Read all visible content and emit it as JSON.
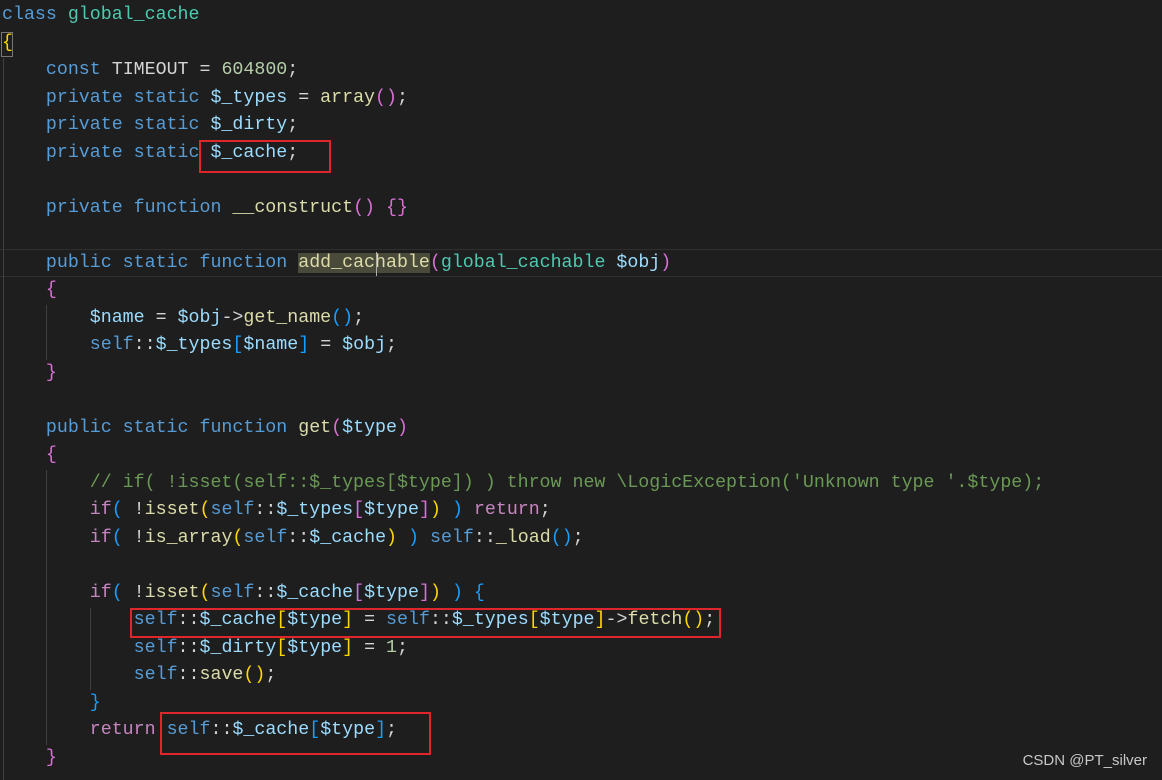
{
  "colors": {
    "keyword": "#569cd6",
    "class": "#4ec9b0",
    "variable": "#9cdcfe",
    "function": "#dcdcaa",
    "number": "#b5cea8",
    "comment": "#6a9955",
    "control": "#c586c0",
    "highlight_box": "#e0262a"
  },
  "code_lines": [
    [
      [
        "class ",
        "kw"
      ],
      [
        "global_cache",
        "cls"
      ]
    ],
    [
      [
        "{",
        "b1"
      ]
    ],
    [
      [
        "    const ",
        "kw"
      ],
      [
        "TIMEOUT = ",
        "def"
      ],
      [
        "604800",
        "num"
      ],
      [
        ";",
        "def"
      ]
    ],
    [
      [
        "    private static ",
        "kw"
      ],
      [
        "$_types",
        "var"
      ],
      [
        " = ",
        "def"
      ],
      [
        "array",
        "fn"
      ],
      [
        "(",
        "b2"
      ],
      [
        ")",
        "b2"
      ],
      [
        ";",
        "def"
      ]
    ],
    [
      [
        "    private static ",
        "kw"
      ],
      [
        "$_dirty",
        "var"
      ],
      [
        ";",
        "def"
      ]
    ],
    [
      [
        "    private static ",
        "kw"
      ],
      [
        "$_cache",
        "var"
      ],
      [
        ";",
        "def"
      ]
    ],
    [],
    [
      [
        "    private function ",
        "kw"
      ],
      [
        "__construct",
        "fn"
      ],
      [
        "()",
        "b2"
      ],
      [
        " ",
        "def"
      ],
      [
        "{}",
        "b2"
      ]
    ],
    [],
    [
      [
        "    public static function ",
        "kw"
      ],
      [
        "add_cachable",
        "hl"
      ],
      [
        "(",
        "b2"
      ],
      [
        "global_cachable ",
        "cls"
      ],
      [
        "$obj",
        "var"
      ],
      [
        ")",
        "b2"
      ]
    ],
    [
      [
        "    ",
        "def"
      ],
      [
        "{",
        "b2"
      ]
    ],
    [
      [
        "        ",
        "def"
      ],
      [
        "$name",
        "var"
      ],
      [
        " = ",
        "def"
      ],
      [
        "$obj",
        "var"
      ],
      [
        "->",
        "def"
      ],
      [
        "get_name",
        "fn"
      ],
      [
        "()",
        "b3"
      ],
      [
        ";",
        "def"
      ]
    ],
    [
      [
        "        ",
        "def"
      ],
      [
        "self",
        "kw"
      ],
      [
        "::",
        "def"
      ],
      [
        "$_types",
        "var"
      ],
      [
        "[",
        "b3"
      ],
      [
        "$name",
        "var"
      ],
      [
        "]",
        "b3"
      ],
      [
        " = ",
        "def"
      ],
      [
        "$obj",
        "var"
      ],
      [
        ";",
        "def"
      ]
    ],
    [
      [
        "    ",
        "def"
      ],
      [
        "}",
        "b2"
      ]
    ],
    [],
    [
      [
        "    public static function ",
        "kw"
      ],
      [
        "get",
        "fn"
      ],
      [
        "(",
        "b2"
      ],
      [
        "$type",
        "var"
      ],
      [
        ")",
        "b2"
      ]
    ],
    [
      [
        "    ",
        "def"
      ],
      [
        "{",
        "b2"
      ]
    ],
    [
      [
        "        // if( !isset(self::$_types[$type]) ) throw new \\LogicException('Unknown type '.$type);",
        "com"
      ]
    ],
    [
      [
        "        ",
        "def"
      ],
      [
        "if",
        "ctl"
      ],
      [
        "(",
        "b3"
      ],
      [
        " !",
        "def"
      ],
      [
        "isset",
        "fn"
      ],
      [
        "(",
        "b1"
      ],
      [
        "self",
        "kw"
      ],
      [
        "::",
        "def"
      ],
      [
        "$_types",
        "var"
      ],
      [
        "[",
        "b2"
      ],
      [
        "$type",
        "var"
      ],
      [
        "]",
        "b2"
      ],
      [
        ")",
        "b1"
      ],
      [
        " ",
        "def"
      ],
      [
        ")",
        "b3"
      ],
      [
        " ",
        "def"
      ],
      [
        "return",
        "ctl"
      ],
      [
        ";",
        "def"
      ]
    ],
    [
      [
        "        ",
        "def"
      ],
      [
        "if",
        "ctl"
      ],
      [
        "(",
        "b3"
      ],
      [
        " !",
        "def"
      ],
      [
        "is_array",
        "fn"
      ],
      [
        "(",
        "b1"
      ],
      [
        "self",
        "kw"
      ],
      [
        "::",
        "def"
      ],
      [
        "$_cache",
        "var"
      ],
      [
        ")",
        "b1"
      ],
      [
        " ",
        "def"
      ],
      [
        ")",
        "b3"
      ],
      [
        " ",
        "def"
      ],
      [
        "self",
        "kw"
      ],
      [
        "::",
        "def"
      ],
      [
        "_load",
        "fn"
      ],
      [
        "()",
        "b3"
      ],
      [
        ";",
        "def"
      ]
    ],
    [],
    [
      [
        "        ",
        "def"
      ],
      [
        "if",
        "ctl"
      ],
      [
        "(",
        "b3"
      ],
      [
        " !",
        "def"
      ],
      [
        "isset",
        "fn"
      ],
      [
        "(",
        "b1"
      ],
      [
        "self",
        "kw"
      ],
      [
        "::",
        "def"
      ],
      [
        "$_cache",
        "var"
      ],
      [
        "[",
        "b2"
      ],
      [
        "$type",
        "var"
      ],
      [
        "]",
        "b2"
      ],
      [
        ")",
        "b1"
      ],
      [
        " ",
        "def"
      ],
      [
        ")",
        "b3"
      ],
      [
        " ",
        "def"
      ],
      [
        "{",
        "b3"
      ]
    ],
    [
      [
        "            ",
        "def"
      ],
      [
        "self",
        "kw"
      ],
      [
        "::",
        "def"
      ],
      [
        "$_cache",
        "var"
      ],
      [
        "[",
        "b1"
      ],
      [
        "$type",
        "var"
      ],
      [
        "]",
        "b1"
      ],
      [
        " = ",
        "def"
      ],
      [
        "self",
        "kw"
      ],
      [
        "::",
        "def"
      ],
      [
        "$_types",
        "var"
      ],
      [
        "[",
        "b1"
      ],
      [
        "$type",
        "var"
      ],
      [
        "]",
        "b1"
      ],
      [
        "->",
        "def"
      ],
      [
        "fetch",
        "fn"
      ],
      [
        "()",
        "b1"
      ],
      [
        ";",
        "def"
      ]
    ],
    [
      [
        "            ",
        "def"
      ],
      [
        "self",
        "kw"
      ],
      [
        "::",
        "def"
      ],
      [
        "$_dirty",
        "var"
      ],
      [
        "[",
        "b1"
      ],
      [
        "$type",
        "var"
      ],
      [
        "]",
        "b1"
      ],
      [
        " = ",
        "def"
      ],
      [
        "1",
        "num"
      ],
      [
        ";",
        "def"
      ]
    ],
    [
      [
        "            ",
        "def"
      ],
      [
        "self",
        "kw"
      ],
      [
        "::",
        "def"
      ],
      [
        "save",
        "fn"
      ],
      [
        "()",
        "b1"
      ],
      [
        ";",
        "def"
      ]
    ],
    [
      [
        "        ",
        "def"
      ],
      [
        "}",
        "b3"
      ]
    ],
    [
      [
        "        ",
        "def"
      ],
      [
        "return",
        "ctl"
      ],
      [
        " ",
        "def"
      ],
      [
        "self",
        "kw"
      ],
      [
        "::",
        "def"
      ],
      [
        "$_cache",
        "var"
      ],
      [
        "[",
        "b3"
      ],
      [
        "$type",
        "var"
      ],
      [
        "]",
        "b3"
      ],
      [
        ";",
        "def"
      ]
    ],
    [
      [
        "    ",
        "def"
      ],
      [
        "}",
        "b2"
      ]
    ]
  ],
  "watermark": "CSDN @PT_silver"
}
